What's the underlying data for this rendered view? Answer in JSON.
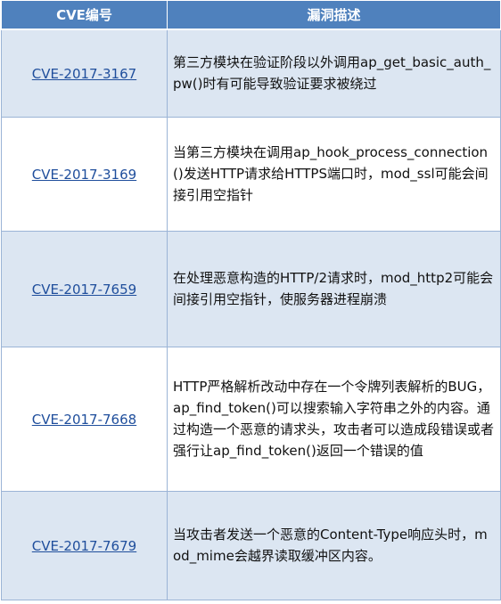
{
  "table": {
    "headers": [
      "CVE编号",
      "漏洞描述"
    ],
    "rows": [
      {
        "id": "CVE-2017-3167",
        "description": "第三方模块在验证阶段以外调用ap_get_basic_auth_pw()时有可能导致验证要求被绕过"
      },
      {
        "id": "CVE-2017-3169",
        "description": "当第三方模块在调用ap_hook_process_connection()发送HTTP请求给HTTPS端口时，mod_ssl可能会间接引用空指针"
      },
      {
        "id": "CVE-2017-7659",
        "description": "在处理恶意构造的HTTP/2请求时，mod_http2可能会间接引用空指针，使服务器进程崩溃"
      },
      {
        "id": "CVE-2017-7668",
        "description": "HTTP严格解析改动中存在一个令牌列表解析的BUG，ap_find_token()可以搜索输入字符串之外的内容。通过构造一个恶意的请求头，攻击者可以造成段错误或者强行让ap_find_token()返回一个错误的值"
      },
      {
        "id": "CVE-2017-7679",
        "description": "当攻击者发送一个恶意的Content-Type响应头时，mod_mime会越界读取缓冲区内容。"
      }
    ]
  }
}
